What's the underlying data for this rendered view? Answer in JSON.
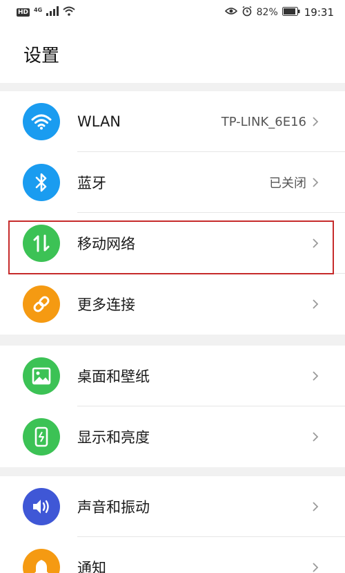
{
  "status_bar": {
    "hd": "HD",
    "net": "4G",
    "battery": "82%",
    "time": "19:31"
  },
  "page": {
    "title": "设置"
  },
  "groups": [
    {
      "items": [
        {
          "id": "wlan",
          "label": "WLAN",
          "value": "TP-LINK_6E16",
          "icon": "wifi-icon",
          "color": "#1a9cf0"
        },
        {
          "id": "bluetooth",
          "label": "蓝牙",
          "value": "已关闭",
          "icon": "bluetooth-icon",
          "color": "#1a9cf0"
        },
        {
          "id": "mobile-network",
          "label": "移动网络",
          "value": "",
          "icon": "mobile-data-icon",
          "color": "#3cc255"
        },
        {
          "id": "more-connections",
          "label": "更多连接",
          "value": "",
          "icon": "link-icon",
          "color": "#f59a12"
        }
      ]
    },
    {
      "items": [
        {
          "id": "wallpaper",
          "label": "桌面和壁纸",
          "value": "",
          "icon": "image-icon",
          "color": "#3cc255"
        },
        {
          "id": "display",
          "label": "显示和亮度",
          "value": "",
          "icon": "phone-brightness-icon",
          "color": "#3cc255"
        }
      ]
    },
    {
      "items": [
        {
          "id": "sound",
          "label": "声音和振动",
          "value": "",
          "icon": "speaker-icon",
          "color": "#3f57d6"
        },
        {
          "id": "notifications",
          "label": "通知",
          "value": "",
          "icon": "bell-icon",
          "color": "#f59a12"
        }
      ]
    }
  ]
}
